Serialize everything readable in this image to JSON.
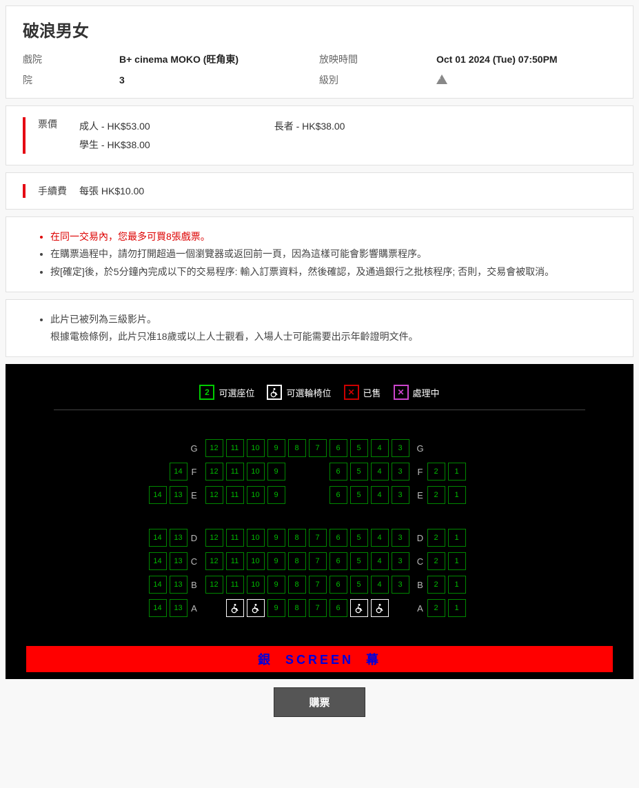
{
  "movie": {
    "title": "破浪男女"
  },
  "info": {
    "cinema_label": "戲院",
    "cinema": "B+ cinema MOKO (旺角東)",
    "time_label": "放映時間",
    "time": "Oct 01 2024 (Tue) 07:50PM",
    "house_label": "院",
    "house": "3",
    "cat_label": "級別"
  },
  "price": {
    "label": "票價",
    "adult": "成人 - HK$53.00",
    "student": "學生 - HK$38.00",
    "senior": "長者 - HK$38.00"
  },
  "fee": {
    "label": "手續費",
    "text": "每張 HK$10.00"
  },
  "notes": [
    "在同一交易內，您最多可買8張戲票。",
    "在購票過程中，請勿打開超過一個瀏覽器或返回前一頁，因為這樣可能會影響購票程序。",
    "按[確定]後，於5分鐘內完成以下的交易程序: 輸入訂票資料，然後確認，及通過銀行之批核程序; 否則，交易會被取消。"
  ],
  "rating_note": {
    "line1": "此片已被列為三級影片。",
    "line2": "根據電檢條例，此片只准18歲或以上人士觀看，入場人士可能需要出示年齡證明文件。"
  },
  "legend": {
    "avail_num": "2",
    "avail": "可選座位",
    "wheel": "可選輪椅位",
    "sold": "已售",
    "proc": "處理中"
  },
  "seatmap": {
    "rows": [
      {
        "label": "G",
        "left": [],
        "center": [
          "12",
          "11",
          "10",
          "9",
          "8",
          "7",
          "6",
          "5",
          "4",
          "3"
        ],
        "right": []
      },
      {
        "label": "F",
        "left": [
          "14"
        ],
        "center": [
          "12",
          "11",
          "10",
          "9",
          "",
          "",
          "6",
          "5",
          "4",
          "3"
        ],
        "right": [
          "2",
          "1"
        ]
      },
      {
        "label": "E",
        "left": [
          "14",
          "13"
        ],
        "center": [
          "12",
          "11",
          "10",
          "9",
          "",
          "",
          "6",
          "5",
          "4",
          "3"
        ],
        "right": [
          "2",
          "1"
        ]
      },
      {
        "label": "",
        "left": [],
        "center": [],
        "right": []
      },
      {
        "label": "D",
        "left": [
          "14",
          "13"
        ],
        "center": [
          "12",
          "11",
          "10",
          "9",
          "8",
          "7",
          "6",
          "5",
          "4",
          "3"
        ],
        "right": [
          "2",
          "1"
        ]
      },
      {
        "label": "C",
        "left": [
          "14",
          "13"
        ],
        "center": [
          "12",
          "11",
          "10",
          "9",
          "8",
          "7",
          "6",
          "5",
          "4",
          "3"
        ],
        "right": [
          "2",
          "1"
        ]
      },
      {
        "label": "B",
        "left": [
          "14",
          "13"
        ],
        "center": [
          "12",
          "11",
          "10",
          "9",
          "8",
          "7",
          "6",
          "5",
          "4",
          "3"
        ],
        "right": [
          "2",
          "1"
        ]
      },
      {
        "label": "A",
        "left": [
          "14",
          "13"
        ],
        "center": [
          "",
          "W",
          "W",
          "9",
          "8",
          "7",
          "6",
          "W",
          "W",
          ""
        ],
        "right": [
          "2",
          "1"
        ]
      }
    ]
  },
  "screen": {
    "left": "銀",
    "mid": "SCREEN",
    "right": "幕"
  },
  "buy_label": "購票"
}
